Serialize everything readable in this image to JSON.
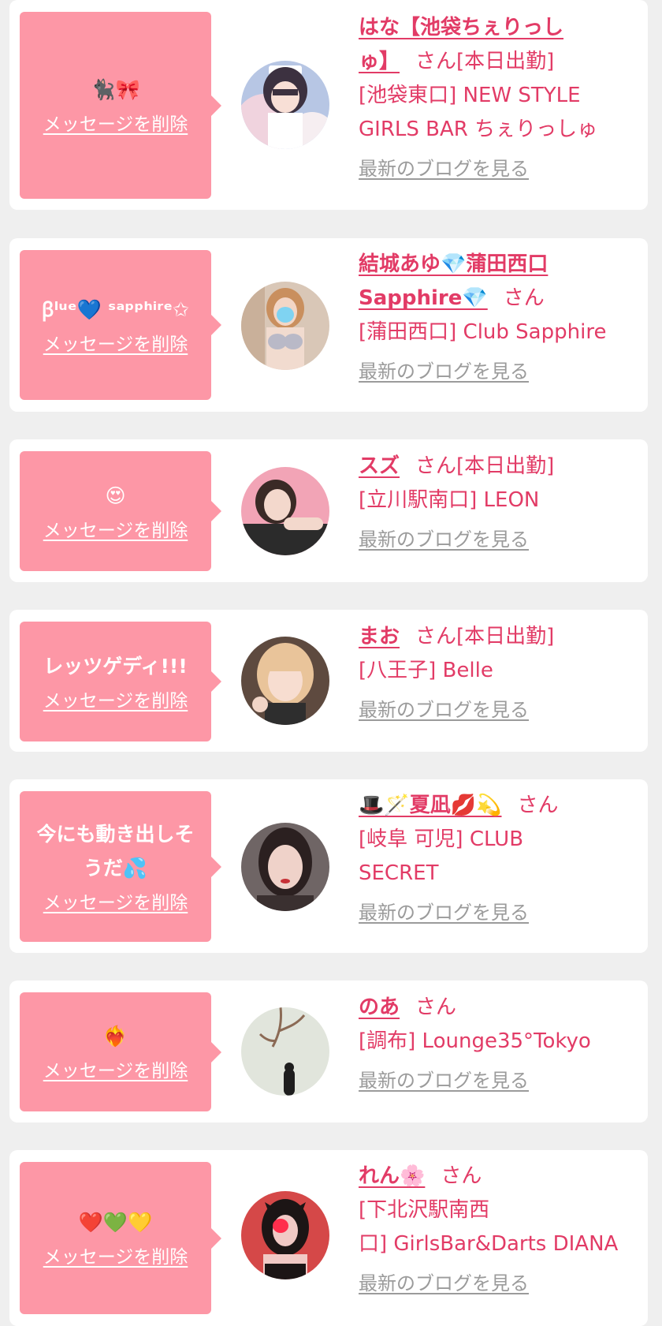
{
  "colors": {
    "background": "#efefef",
    "card": "#ffffff",
    "bubble": "#fd97a6",
    "accent_pink": "#e23b66",
    "link_gray": "#9b9b9b"
  },
  "delete_label": "メッセージを削除",
  "blog_label": "最新のブログを見る",
  "san_label": "さん",
  "messages": [
    {
      "bubble": [
        "🐈‍⬛🎀"
      ],
      "name_lines": [
        "はな【池袋ちぇりっし",
        "ゅ】"
      ],
      "status": "[本日出勤]",
      "shop_lines": [
        "[池袋東口] NEW STYLE",
        "GIRLS BAR ちぇりっしゅ"
      ]
    },
    {
      "bubble": [
        "ꞵˡᵘᵉ💙 ˢᵃᵖᵖʰⁱʳᵉ✩"
      ],
      "name_lines": [
        "結城あゆ💎蒲田西口",
        "Sapphire💎"
      ],
      "status": "",
      "shop_lines": [
        "[蒲田西口] Club Sapphire"
      ]
    },
    {
      "bubble": [
        "😍"
      ],
      "name_lines": [
        "スズ"
      ],
      "status": "[本日出勤]",
      "shop_lines": [
        "[立川駅南口] LEON"
      ]
    },
    {
      "bubble": [
        "レッツゲディ!!!"
      ],
      "name_lines": [
        "まお"
      ],
      "status": "[本日出勤]",
      "shop_lines": [
        "[八王子] Belle"
      ]
    },
    {
      "bubble": [
        "今にも動き出しそ",
        "うだ💦"
      ],
      "name_lines": [
        "🎩🪄夏凪💋💫"
      ],
      "status": "",
      "shop_lines": [
        "[岐阜 可児] CLUB",
        "SECRET"
      ]
    },
    {
      "bubble": [
        "❤️‍🔥"
      ],
      "name_lines": [
        "のあ"
      ],
      "status": "",
      "shop_lines": [
        "[調布] Lounge35°Tokyo"
      ]
    },
    {
      "bubble": [
        "❤️💚💛"
      ],
      "name_lines": [
        "れん🌸"
      ],
      "status": "",
      "shop_lines": [
        "[下北沢駅南西",
        "口] GirlsBar&Darts DIANA"
      ]
    }
  ]
}
